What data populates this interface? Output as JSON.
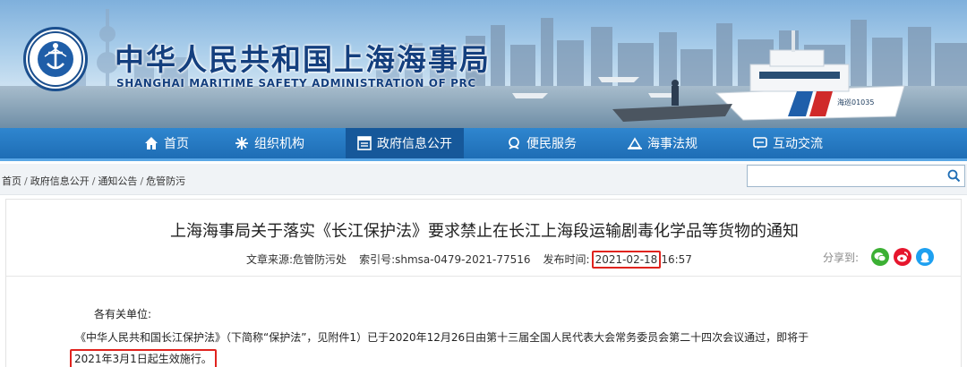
{
  "header": {
    "title": "中华人民共和国上海海事局",
    "subtitle": "SHANGHAI MARITIME SAFETY ADMINISTRATION OF PRC",
    "logo_text_top": "中国海事",
    "logo_text_bottom": "CHINA MSA",
    "boat_mark": "海巡01035"
  },
  "nav": {
    "items": [
      {
        "label": "首页",
        "icon": "home-icon"
      },
      {
        "label": "组织机构",
        "icon": "org-icon"
      },
      {
        "label": "政府信息公开",
        "icon": "document-icon",
        "active": true
      },
      {
        "label": "便民服务",
        "icon": "service-icon"
      },
      {
        "label": "海事法规",
        "icon": "law-icon"
      },
      {
        "label": "互动交流",
        "icon": "chat-icon"
      }
    ]
  },
  "breadcrumb": [
    "首页",
    "政府信息公开",
    "通知公告",
    "危管防污"
  ],
  "search": {
    "value": "",
    "placeholder": ""
  },
  "article": {
    "title": "上海海事局关于落实《长江保护法》要求禁止在长江上海段运输剧毒化学品等货物的通知",
    "source_label": "文章来源:",
    "source_value": "危管防污处",
    "index_label": "索引号:",
    "index_value": "shmsa-0479-2021-77516",
    "published_label": "发布时间:",
    "published_date": "2021-02-18",
    "published_time": "16:57",
    "share_label": "分享到:",
    "salutation": "各有关单位:",
    "paragraph_line1": "《中华人民共和国长江保护法》（下简称“保护法”，见附件1）已于2020年12月26日由第十三届全国人民代表大会常务委员会第二十四次会议通过，即将于",
    "paragraph_line2": "2021年3月1日起生效施行。"
  },
  "colors": {
    "nav_bg": "#1e6db5",
    "nav_active": "#16589a",
    "title_blue": "#143f7e",
    "highlight_red": "#e0231e",
    "wechat_green": "#3cb034",
    "weibo_red": "#e6162d",
    "qq_blue": "#1ea0f0"
  }
}
